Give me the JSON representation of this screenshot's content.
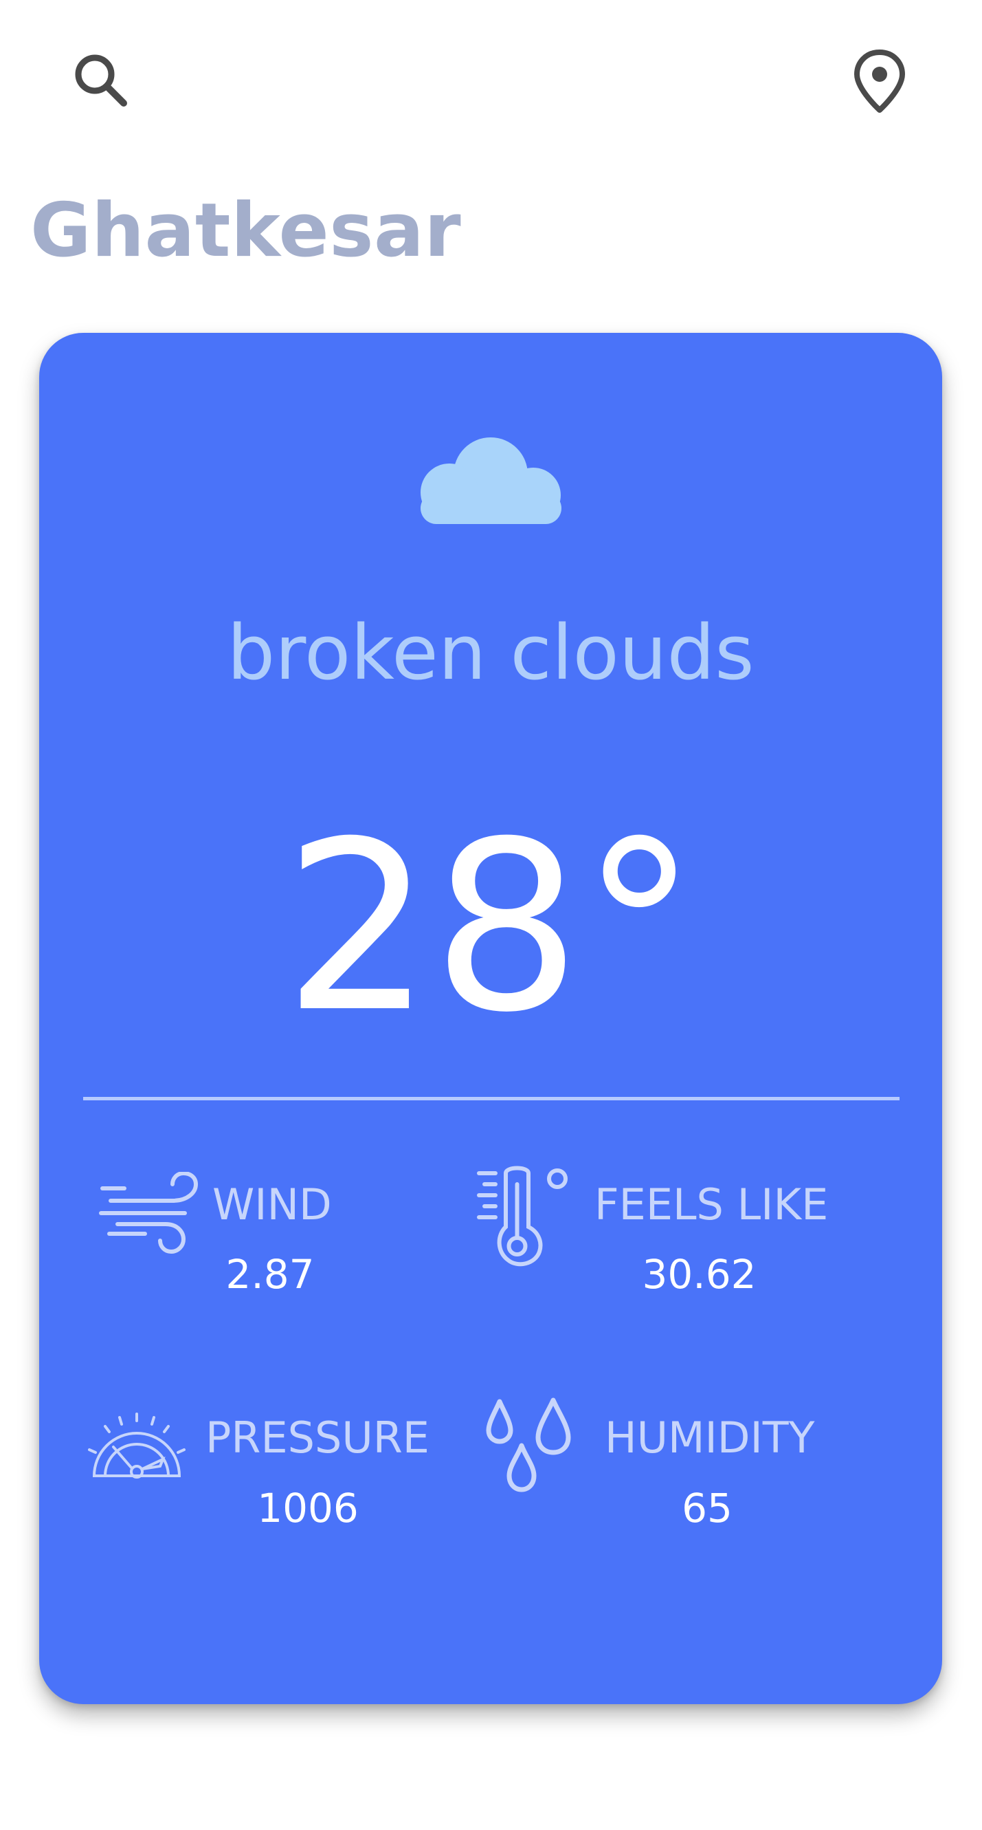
{
  "header": {
    "search_icon": "search-icon",
    "location_icon": "location-pin-icon"
  },
  "city": "Ghatkesar",
  "weather": {
    "icon": "cloud-icon",
    "description": "broken clouds",
    "temperature": "28°"
  },
  "stats": {
    "wind": {
      "icon": "wind-icon",
      "label": "WIND",
      "value": "2.87"
    },
    "feels_like": {
      "icon": "thermometer-icon",
      "label": "FEELS LIKE",
      "value": "30.62"
    },
    "pressure": {
      "icon": "gauge-icon",
      "label": "PRESSURE",
      "value": "1006"
    },
    "humidity": {
      "icon": "water-drops-icon",
      "label": "HUMIDITY",
      "value": "65"
    }
  },
  "colors": {
    "card_background": "#4a73f9",
    "city_text": "#a3aecb",
    "description_text": "#aecdfb",
    "cloud": "#a9d4fa",
    "stat_label": "#c7d5fb",
    "value_text": "#ffffff",
    "icon_dark": "#4a4a4a"
  }
}
